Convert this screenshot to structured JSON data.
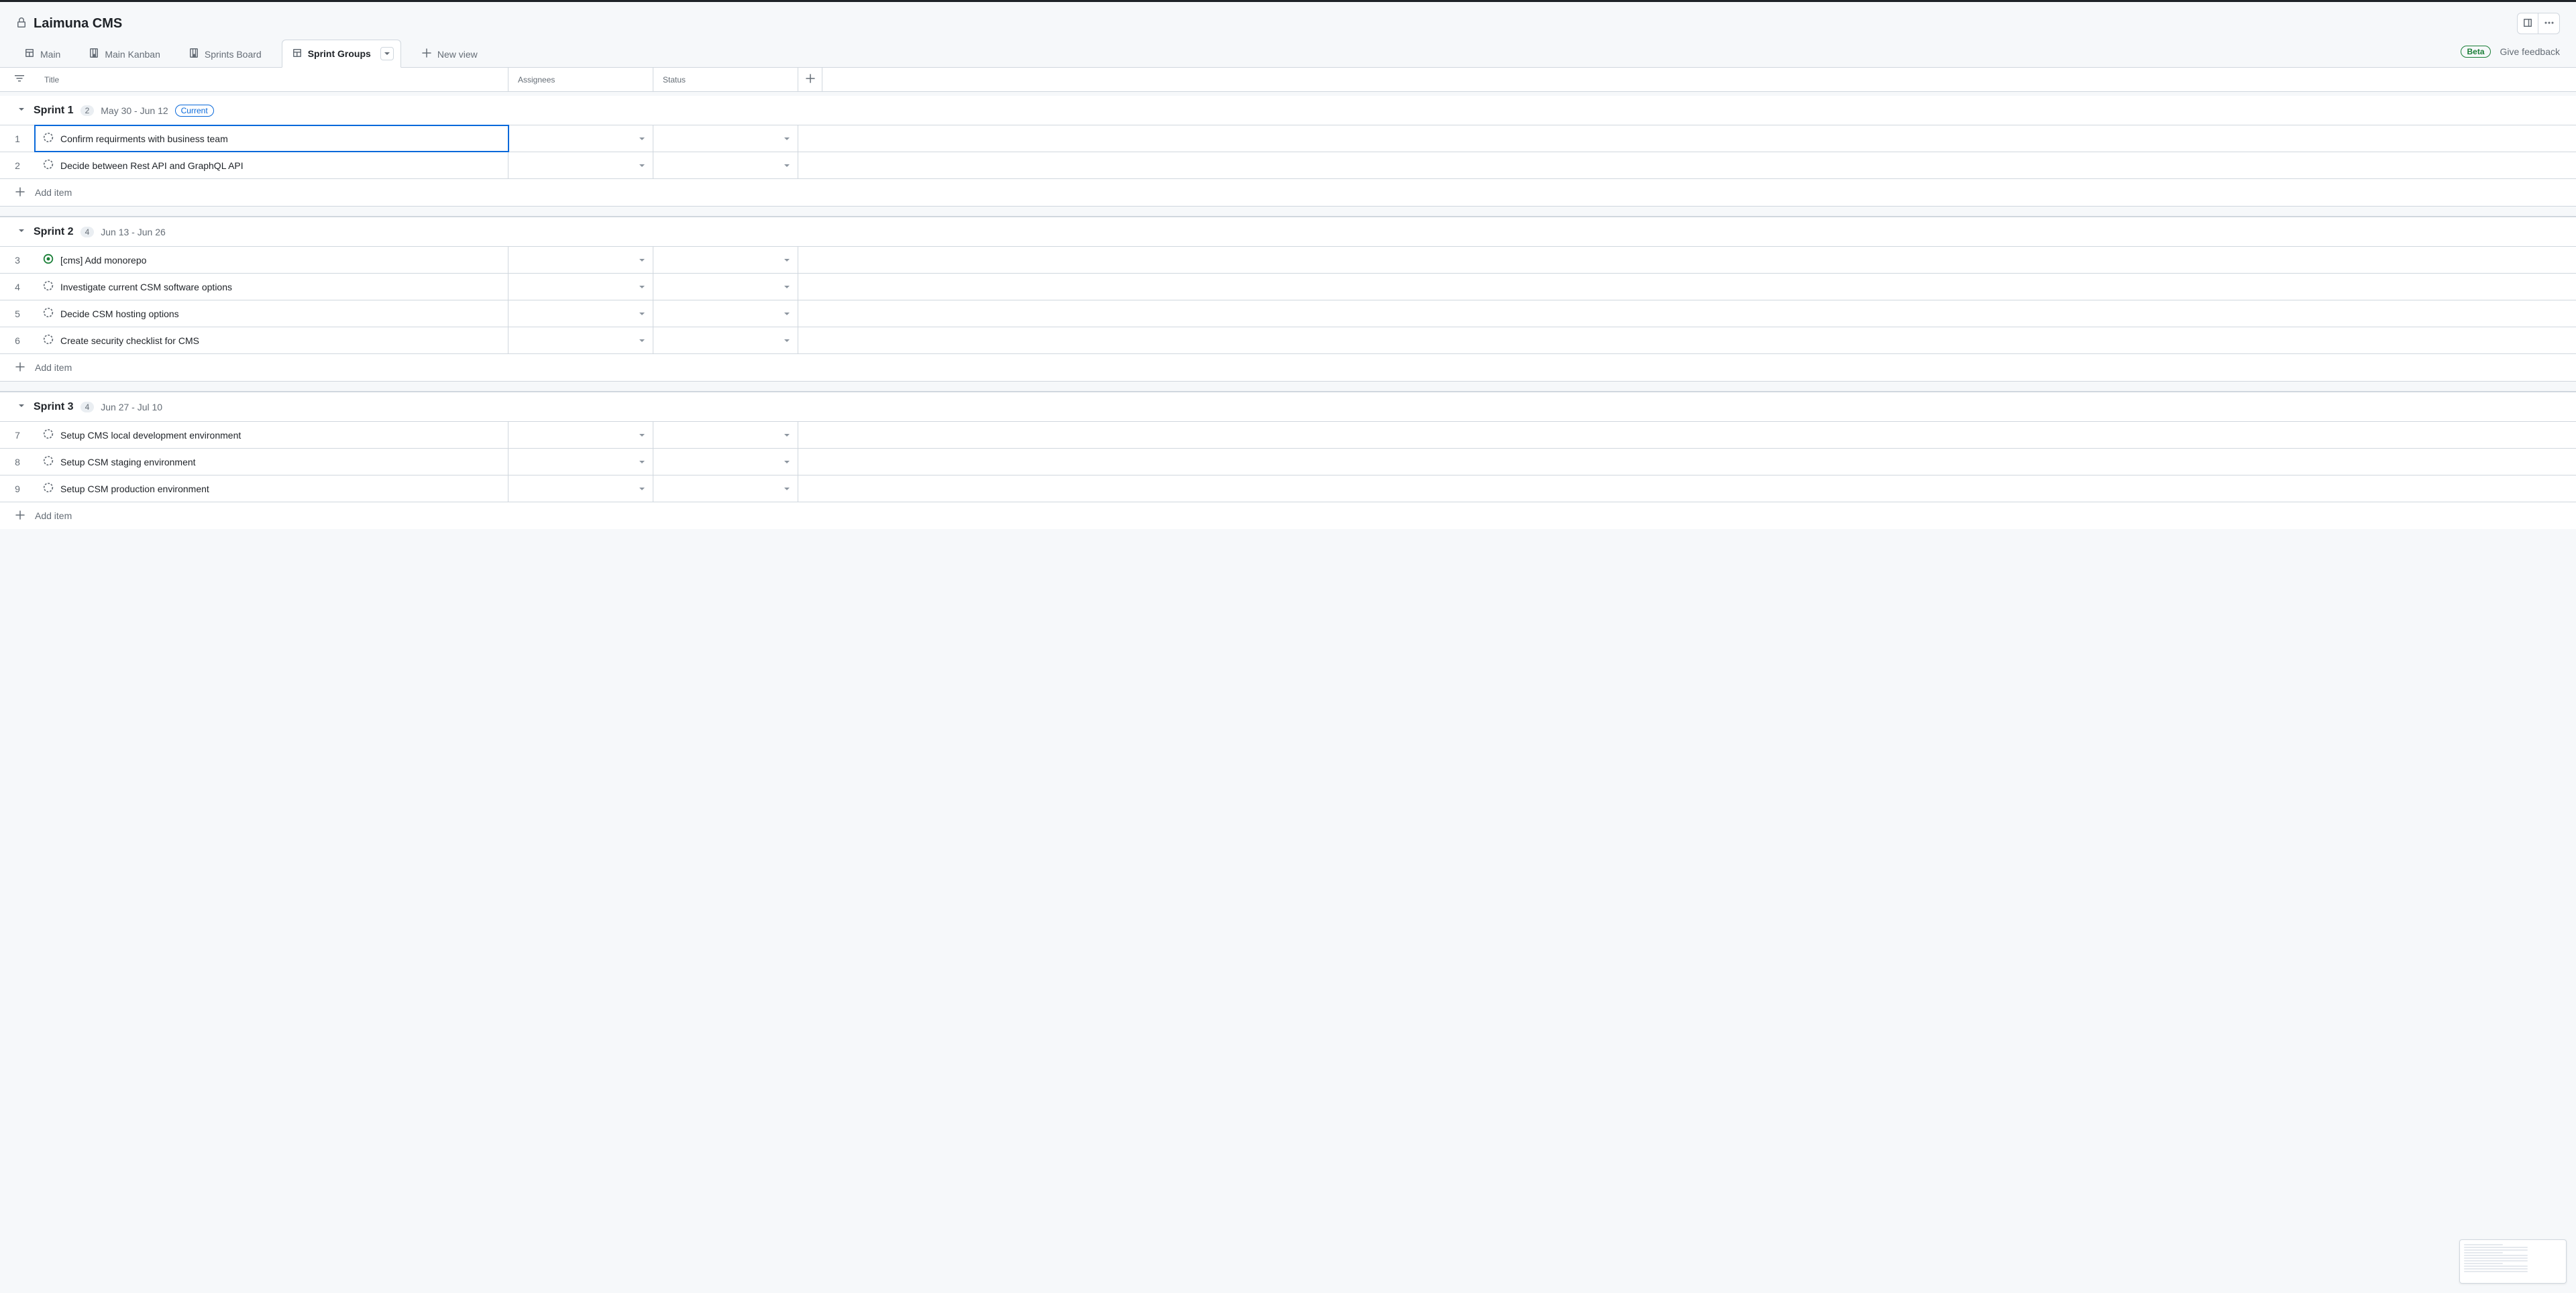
{
  "project": {
    "title": "Laimuna CMS"
  },
  "tabs": [
    {
      "label": "Main",
      "icon": "table"
    },
    {
      "label": "Main Kanban",
      "icon": "kanban"
    },
    {
      "label": "Sprints Board",
      "icon": "kanban"
    },
    {
      "label": "Sprint Groups",
      "icon": "table",
      "active": true
    }
  ],
  "new_view_label": "New view",
  "beta_label": "Beta",
  "feedback_label": "Give feedback",
  "columns": {
    "title": "Title",
    "assignees": "Assignees",
    "status": "Status"
  },
  "add_item_label": "Add item",
  "groups": [
    {
      "name": "Sprint 1",
      "count": "2",
      "dates": "May 30 - Jun 12",
      "current": true,
      "current_label": "Current",
      "items": [
        {
          "num": "1",
          "title": "Confirm requirments with business team",
          "kind": "draft",
          "selected": true
        },
        {
          "num": "2",
          "title": "Decide between Rest API and GraphQL API",
          "kind": "draft"
        }
      ]
    },
    {
      "name": "Sprint 2",
      "count": "4",
      "dates": "Jun 13 - Jun 26",
      "items": [
        {
          "num": "3",
          "title": "[cms] Add monorepo",
          "kind": "open"
        },
        {
          "num": "4",
          "title": "Investigate current CSM software options",
          "kind": "draft"
        },
        {
          "num": "5",
          "title": "Decide CSM hosting options",
          "kind": "draft"
        },
        {
          "num": "6",
          "title": "Create security checklist for CMS",
          "kind": "draft"
        }
      ]
    },
    {
      "name": "Sprint 3",
      "count": "4",
      "dates": "Jun 27 - Jul 10",
      "items": [
        {
          "num": "7",
          "title": "Setup CMS local development environment",
          "kind": "draft"
        },
        {
          "num": "8",
          "title": "Setup CSM staging environment",
          "kind": "draft"
        },
        {
          "num": "9",
          "title": "Setup CSM production environment",
          "kind": "draft"
        }
      ]
    }
  ]
}
